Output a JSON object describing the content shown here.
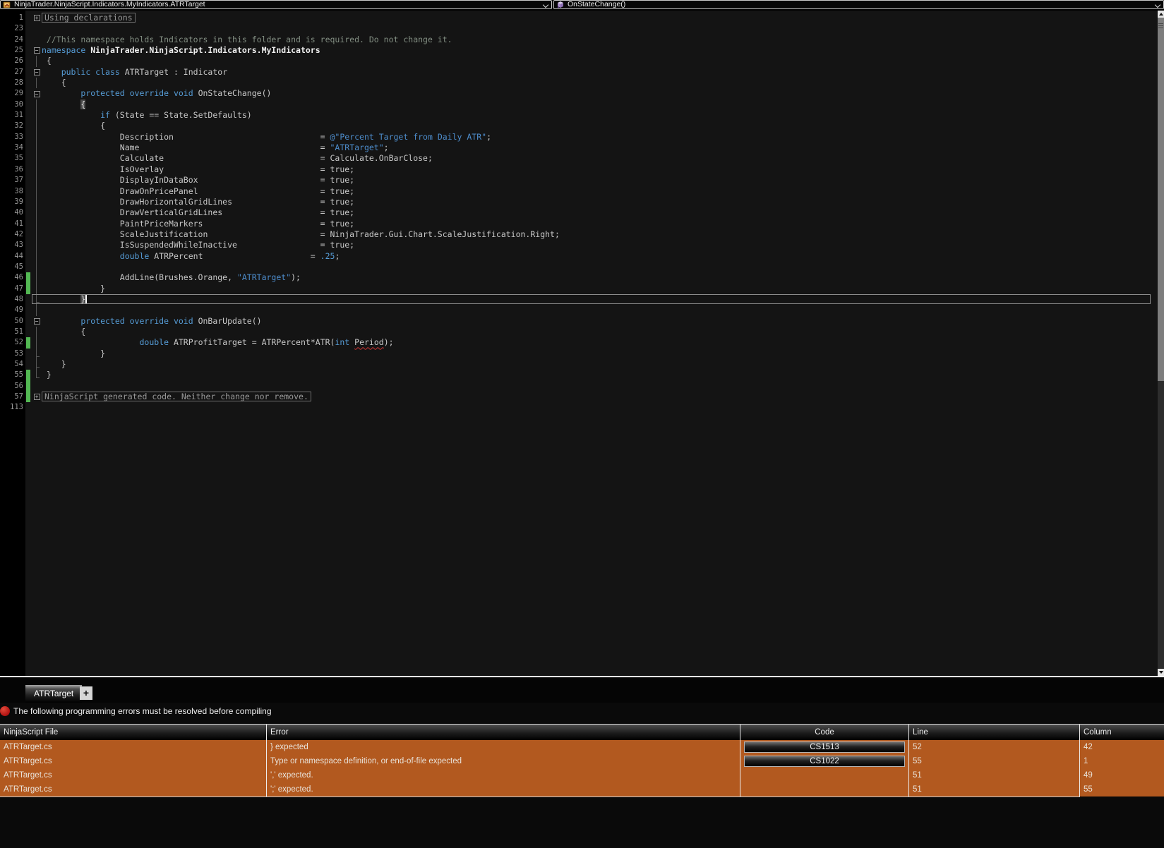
{
  "navbar": {
    "scope_selector": {
      "label": "NinjaTrader.NinjaScript.Indicators.MyIndicators.ATRTarget",
      "icon": "class-icon"
    },
    "member_selector": {
      "label": "OnStateChange()",
      "icon": "method-icon"
    }
  },
  "editor": {
    "lines": [
      {
        "n": "1",
        "fold": "plus",
        "box": true,
        "segs": [
          [
            "dim",
            "Using declarations"
          ]
        ]
      },
      {
        "n": "23"
      },
      {
        "n": "24",
        "segs": [
          [
            "c",
            " //This namespace holds Indicators in this folder and is required. Do not change it."
          ]
        ]
      },
      {
        "n": "25",
        "fold": "minus",
        "segs": [
          [
            "k",
            "namespace "
          ],
          [
            "b",
            "NinjaTrader.NinjaScript.Indicators.MyIndicators"
          ]
        ]
      },
      {
        "n": "26",
        "fold": "line",
        "segs": [
          [
            "p",
            " {"
          ]
        ]
      },
      {
        "n": "27",
        "fold": "minus",
        "segs": [
          [
            "p",
            "    "
          ],
          [
            "k",
            "public class "
          ],
          [
            "p",
            "ATRTarget : Indicator"
          ]
        ]
      },
      {
        "n": "28",
        "fold": "line",
        "segs": [
          [
            "p",
            "    {"
          ]
        ]
      },
      {
        "n": "29",
        "fold": "minus",
        "segs": [
          [
            "p",
            "        "
          ],
          [
            "k",
            "protected override void "
          ],
          [
            "p",
            "OnStateChange()"
          ]
        ]
      },
      {
        "n": "30",
        "fold": "line",
        "segs": [
          [
            "p",
            "        "
          ],
          [
            "bh",
            "{"
          ]
        ]
      },
      {
        "n": "31",
        "fold": "line",
        "segs": [
          [
            "p",
            "            "
          ],
          [
            "k",
            "if "
          ],
          [
            "p",
            "(State == State.SetDefaults)"
          ]
        ]
      },
      {
        "n": "32",
        "fold": "line",
        "segs": [
          [
            "p",
            "            {"
          ]
        ]
      },
      {
        "n": "33",
        "fold": "line",
        "segs": [
          [
            "p",
            "                Description                              = "
          ],
          [
            "s",
            "@\"Percent Target from Daily ATR\""
          ],
          [
            "p",
            ";"
          ]
        ]
      },
      {
        "n": "34",
        "fold": "line",
        "segs": [
          [
            "p",
            "                Name                                     = "
          ],
          [
            "s",
            "\"ATRTarget\""
          ],
          [
            "p",
            ";"
          ]
        ]
      },
      {
        "n": "35",
        "fold": "line",
        "segs": [
          [
            "p",
            "                Calculate                                = Calculate.OnBarClose;"
          ]
        ]
      },
      {
        "n": "36",
        "fold": "line",
        "segs": [
          [
            "p",
            "                IsOverlay                                = true;"
          ]
        ]
      },
      {
        "n": "37",
        "fold": "line",
        "segs": [
          [
            "p",
            "                DisplayInDataBox                         = true;"
          ]
        ]
      },
      {
        "n": "38",
        "fold": "line",
        "segs": [
          [
            "p",
            "                DrawOnPricePanel                         = true;"
          ]
        ]
      },
      {
        "n": "39",
        "fold": "line",
        "segs": [
          [
            "p",
            "                DrawHorizontalGridLines                  = true;"
          ]
        ]
      },
      {
        "n": "40",
        "fold": "line",
        "segs": [
          [
            "p",
            "                DrawVerticalGridLines                    = true;"
          ]
        ]
      },
      {
        "n": "41",
        "fold": "line",
        "segs": [
          [
            "p",
            "                PaintPriceMarkers                        = true;"
          ]
        ]
      },
      {
        "n": "42",
        "fold": "line",
        "segs": [
          [
            "p",
            "                ScaleJustification                       = NinjaTrader.Gui.Chart.ScaleJustification.Right;"
          ]
        ]
      },
      {
        "n": "43",
        "fold": "line",
        "segs": [
          [
            "p",
            "                IsSuspendedWhileInactive                 = true;"
          ]
        ]
      },
      {
        "n": "44",
        "fold": "line",
        "segs": [
          [
            "p",
            "                "
          ],
          [
            "k",
            "double"
          ],
          [
            "p",
            " ATRPercent                      = "
          ],
          [
            "n",
            ".25"
          ],
          [
            "p",
            ";"
          ]
        ]
      },
      {
        "n": "45",
        "fold": "line"
      },
      {
        "n": "46",
        "fold": "line",
        "chg": true,
        "segs": [
          [
            "p",
            "                AddLine(Brushes.Orange, "
          ],
          [
            "s",
            "\"ATRTarget\""
          ],
          [
            "p",
            ");"
          ]
        ]
      },
      {
        "n": "47",
        "fold": "line",
        "chg": true,
        "segs": [
          [
            "p",
            "            }"
          ]
        ]
      },
      {
        "n": "48",
        "fold": "tick",
        "cur": true,
        "segs": [
          [
            "p",
            "        "
          ],
          [
            "bh",
            "}"
          ]
        ]
      },
      {
        "n": "49",
        "fold": "line"
      },
      {
        "n": "50",
        "fold": "minus",
        "segs": [
          [
            "p",
            "        "
          ],
          [
            "k",
            "protected override void "
          ],
          [
            "p",
            "OnBarUpdate()"
          ]
        ]
      },
      {
        "n": "51",
        "fold": "line",
        "segs": [
          [
            "p",
            "        {"
          ]
        ]
      },
      {
        "n": "52",
        "fold": "line",
        "chg": true,
        "segs": [
          [
            "p",
            "                    "
          ],
          [
            "k",
            "double"
          ],
          [
            "p",
            " ATRProfitTarget = ATRPercent*ATR("
          ],
          [
            "k",
            "int"
          ],
          [
            "p",
            " "
          ],
          [
            "sq",
            "Period"
          ],
          [
            "p",
            ");"
          ]
        ]
      },
      {
        "n": "53",
        "fold": "tick",
        "segs": [
          [
            "p",
            "            }"
          ]
        ]
      },
      {
        "n": "54",
        "fold": "tick",
        "segs": [
          [
            "p",
            "    }"
          ]
        ]
      },
      {
        "n": "55",
        "fold": "end",
        "chg": true,
        "segs": [
          [
            "p",
            " }"
          ]
        ]
      },
      {
        "n": "56",
        "chg": true
      },
      {
        "n": "57",
        "fold": "plus",
        "chg": true,
        "box": true,
        "segs": [
          [
            "dim",
            "NinjaScript generated code. Neither change nor remove."
          ]
        ]
      },
      {
        "n": "113"
      }
    ]
  },
  "tabs": {
    "active": "ATRTarget",
    "add_button": "+"
  },
  "status": {
    "message": "The following programming errors must be resolved before compiling"
  },
  "error_table": {
    "columns": [
      "NinjaScript File",
      "Error",
      "Code",
      "Line",
      "Column"
    ],
    "rows": [
      {
        "file": "ATRTarget.cs",
        "error": "} expected",
        "code": "CS1513",
        "line": "52",
        "column": "42"
      },
      {
        "file": "ATRTarget.cs",
        "error": "Type or namespace definition, or end-of-file expected",
        "code": "CS1022",
        "line": "55",
        "column": "1"
      },
      {
        "file": "ATRTarget.cs",
        "error": "',' expected.",
        "code": "",
        "line": "51",
        "column": "49"
      },
      {
        "file": "ATRTarget.cs",
        "error": "';' expected.",
        "code": "",
        "line": "51",
        "column": "55"
      }
    ]
  },
  "colors": {
    "keyword": "#569CD6",
    "string": "#4D8CCB",
    "comment": "#828E82",
    "editor_bg": "#141414",
    "error_row_bg": "#B2591F",
    "change_bar": "#53B853",
    "error_icon": "#CC2222"
  }
}
